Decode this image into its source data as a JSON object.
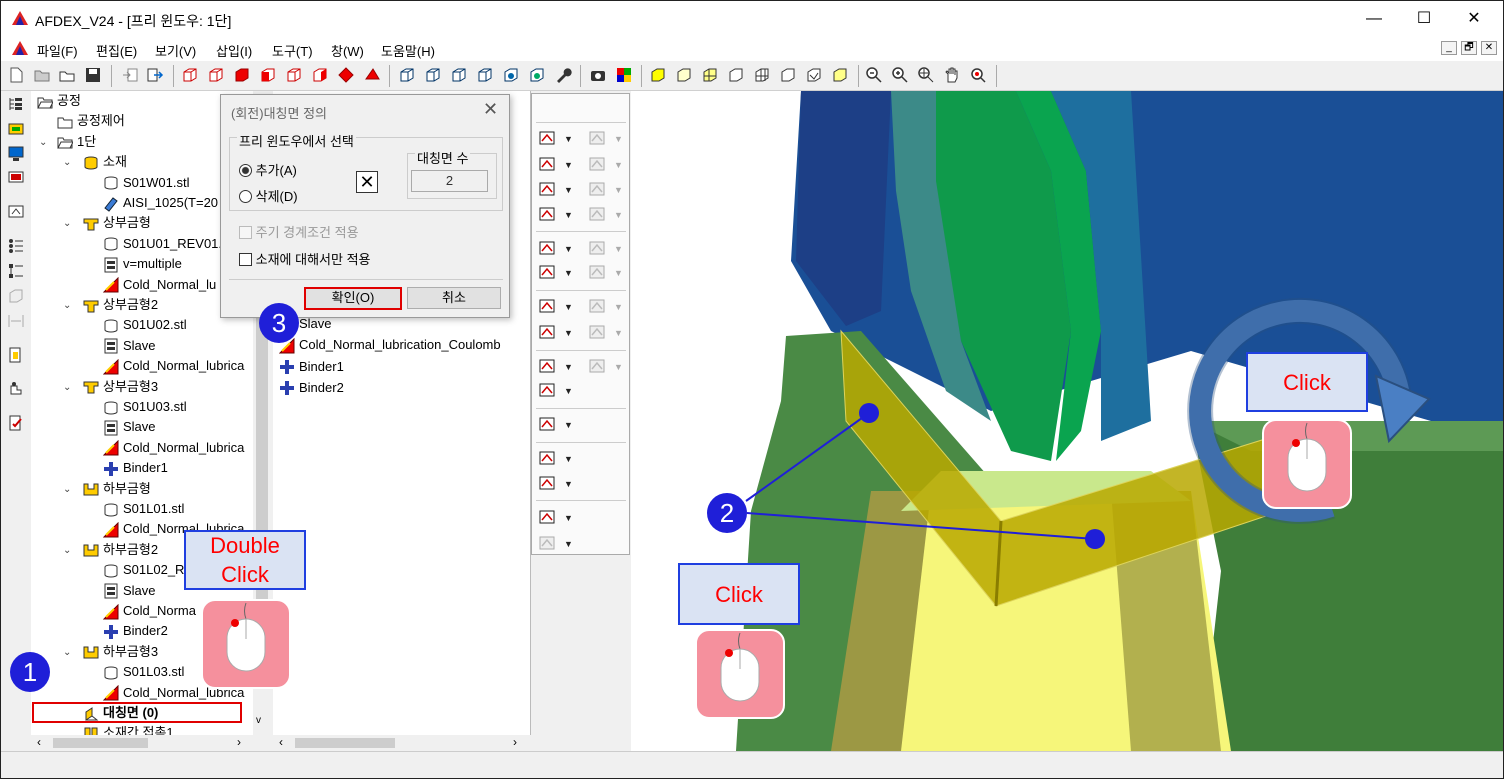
{
  "window": {
    "title": "AFDEX_V24 - [프리 윈도우: 1단]",
    "controls": [
      "—",
      "☐",
      "✕"
    ]
  },
  "menu": [
    "파일(F)",
    "편집(E)",
    "보기(V)",
    "삽입(I)",
    "도구(T)",
    "창(W)",
    "도움말(H)"
  ],
  "mdi_controls": [
    "_",
    "🗗",
    "✕"
  ],
  "tree": {
    "nodes": [
      {
        "label": "공정",
        "level": 0,
        "icon": "folder-open-icon"
      },
      {
        "label": "공정제어",
        "level": 1,
        "icon": "folder-icon"
      },
      {
        "label": "1단",
        "level": 1,
        "icon": "folder-open-icon",
        "expand": "v"
      },
      {
        "label": "소재",
        "level": 2,
        "icon": "material-icon",
        "expand": "v"
      },
      {
        "label": "S01W01.stl",
        "level": 3,
        "icon": "mesh-icon"
      },
      {
        "label": "AISI_1025(T=20",
        "level": 3,
        "icon": "material-prop-icon"
      },
      {
        "label": "상부금형",
        "level": 2,
        "icon": "upper-die-icon",
        "expand": "v"
      },
      {
        "label": "S01U01_REV01.",
        "level": 3,
        "icon": "mesh-icon"
      },
      {
        "label": "v=multiple",
        "level": 3,
        "icon": "press-icon"
      },
      {
        "label": "Cold_Normal_lu",
        "level": 3,
        "icon": "friction-icon"
      },
      {
        "label": "상부금형2",
        "level": 2,
        "icon": "upper-die-icon",
        "expand": "v"
      },
      {
        "label": "S01U02.stl",
        "level": 3,
        "icon": "mesh-icon"
      },
      {
        "label": "Slave",
        "level": 3,
        "icon": "press-icon"
      },
      {
        "label": "Cold_Normal_lubrica",
        "level": 3,
        "icon": "friction-icon"
      },
      {
        "label": "상부금형3",
        "level": 2,
        "icon": "upper-die-icon",
        "expand": "v"
      },
      {
        "label": "S01U03.stl",
        "level": 3,
        "icon": "mesh-icon"
      },
      {
        "label": "Slave",
        "level": 3,
        "icon": "press-icon"
      },
      {
        "label": "Cold_Normal_lubrica",
        "level": 3,
        "icon": "friction-icon"
      },
      {
        "label": "Binder1",
        "level": 3,
        "icon": "binder-icon"
      },
      {
        "label": "하부금형",
        "level": 2,
        "icon": "lower-die-icon",
        "expand": "v"
      },
      {
        "label": "S01L01.stl",
        "level": 3,
        "icon": "mesh-icon"
      },
      {
        "label": "Cold_Normal_lubrica",
        "level": 3,
        "icon": "friction-icon"
      },
      {
        "label": "하부금형2",
        "level": 2,
        "icon": "lower-die-icon",
        "expand": "v"
      },
      {
        "label": "S01L02_R",
        "level": 3,
        "icon": "mesh-icon"
      },
      {
        "label": "Slave",
        "level": 3,
        "icon": "press-icon"
      },
      {
        "label": "Cold_Norma",
        "level": 3,
        "icon": "friction-icon"
      },
      {
        "label": "Binder2",
        "level": 3,
        "icon": "binder-icon"
      },
      {
        "label": "하부금형3",
        "level": 2,
        "icon": "lower-die-icon",
        "expand": "v"
      },
      {
        "label": "S01L03.stl",
        "level": 3,
        "icon": "mesh-icon"
      },
      {
        "label": "Cold_Normal_lubrica",
        "level": 3,
        "icon": "friction-icon"
      },
      {
        "label": "대칭면 (0)",
        "level": 2,
        "icon": "symmetry-icon",
        "bold": true
      },
      {
        "label": "소재간 접촉1",
        "level": 2,
        "icon": "contact-icon"
      }
    ]
  },
  "list": {
    "items": [
      {
        "label": "Slave",
        "icon": "press-icon"
      },
      {
        "label": "Cold_Normal_lubrication_Coulomb",
        "icon": "friction-icon"
      },
      {
        "label": "Binder1",
        "icon": "binder-icon"
      },
      {
        "label": "Binder2",
        "icon": "binder-icon"
      }
    ]
  },
  "dialog": {
    "title": "(회전)대칭면 정의",
    "group_label": "프리 윈도우에서 선택",
    "radio_add": "추가(A)",
    "radio_delete": "삭제(D)",
    "count_label": "대칭면 수",
    "count_value": "2",
    "chk_periodic": "주기 경계조건 적용",
    "chk_material_only": "소재에 대해서만 적용",
    "ok": "확인(O)",
    "cancel": "취소"
  },
  "annotations": {
    "double_click": "Double Click",
    "click_view": "Click",
    "click_rotate": "Click",
    "step1": "1",
    "step2": "2",
    "step3": "3"
  },
  "colors": {
    "callout_border": "#1f3fe0",
    "callout_fill": "#dae3f3",
    "callout_text": "#ff0000",
    "step_circle": "#1f1fd8",
    "mouse_bg": "#f5909d",
    "highlight_box": "#e00000",
    "plane_yellow": "#b8a800",
    "blue_die": "#1f4f9a",
    "green_die": "#3a8a3a"
  }
}
